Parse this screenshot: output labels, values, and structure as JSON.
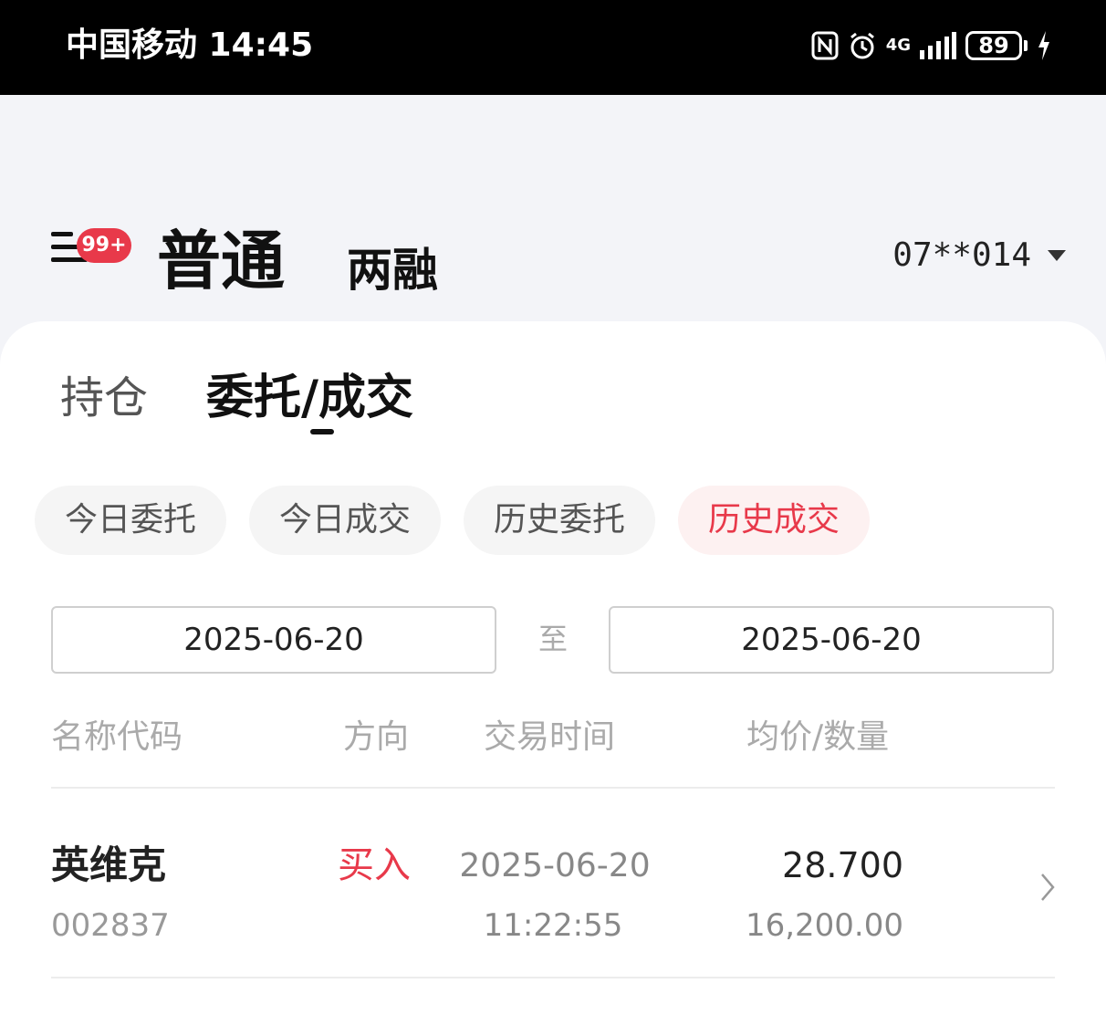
{
  "status_bar": {
    "carrier_time": "中国移动 14:45",
    "network": "4G",
    "battery": "89"
  },
  "header": {
    "badge": "99+",
    "tab_active": "普通",
    "tab_other": "两融",
    "account": "07**014"
  },
  "tabs": {
    "holdings": "持仓",
    "orders": "委托/成交"
  },
  "filters": [
    {
      "label": "今日委托",
      "active": false
    },
    {
      "label": "今日成交",
      "active": false
    },
    {
      "label": "历史委托",
      "active": false
    },
    {
      "label": "历史成交",
      "active": true
    }
  ],
  "date_range": {
    "start": "2025-06-20",
    "separator": "至",
    "end": "2025-06-20"
  },
  "table": {
    "headers": [
      "名称代码",
      "方向",
      "交易时间",
      "均价/数量"
    ],
    "rows": [
      {
        "name": "英维克",
        "code": "002837",
        "direction": "买入",
        "date": "2025-06-20",
        "time": "11:22:55",
        "price": "28.700",
        "quantity": "16,200.00"
      }
    ]
  },
  "colors": {
    "accent_red": "#e8394a",
    "background": "#f3f4f8"
  }
}
